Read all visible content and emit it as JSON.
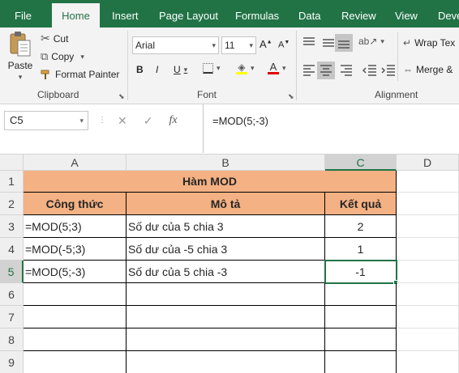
{
  "ribbon_tabs": [
    "File",
    "Home",
    "Insert",
    "Page Layout",
    "Formulas",
    "Data",
    "Review",
    "View",
    "Deve"
  ],
  "clipboard": {
    "paste": "Paste",
    "cut": "Cut",
    "copy": "Copy",
    "format_painter": "Format Painter",
    "label": "Clipboard"
  },
  "font": {
    "name": "Arial",
    "size": "11",
    "bold": "B",
    "italic": "I",
    "underline": "U",
    "label": "Font"
  },
  "alignment": {
    "wrap_text": "Wrap Tex",
    "merge": "Merge &",
    "label": "Alignment"
  },
  "formula_bar": {
    "name_box": "C5",
    "fx": "fx",
    "formula": "=MOD(5;-3)"
  },
  "columns": [
    "A",
    "B",
    "C",
    "D"
  ],
  "rows": [
    "1",
    "2",
    "3",
    "4",
    "5",
    "6",
    "7",
    "8",
    "9"
  ],
  "sheet": {
    "title": "Hàm MOD",
    "headers": [
      "Công thức",
      "Mô tả",
      "Kết quả"
    ],
    "data": [
      {
        "formula": "=MOD(5;3)",
        "desc": "Số dư của 5 chia 3",
        "result": "2"
      },
      {
        "formula": "=MOD(-5;3)",
        "desc": "Số dư của -5 chia 3",
        "result": "1"
      },
      {
        "formula": "=MOD(5;-3)",
        "desc": "Số dư của 5 chia -3",
        "result": "-1"
      }
    ]
  },
  "colors": {
    "excel_green": "#217346",
    "header_fill": "#f4b183"
  }
}
